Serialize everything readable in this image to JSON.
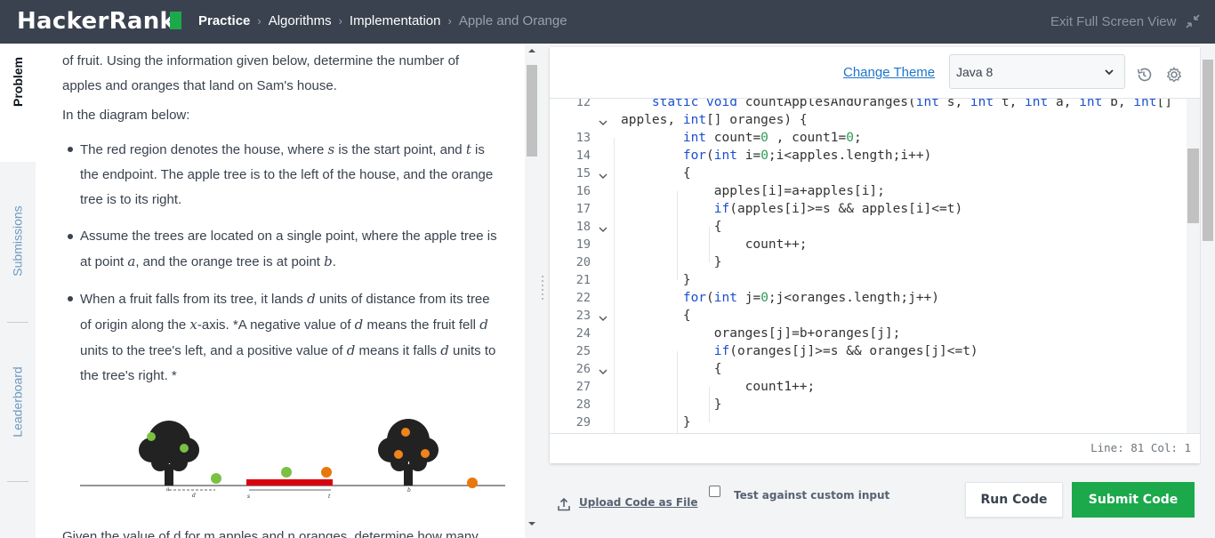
{
  "header": {
    "logo": "HackerRank",
    "breadcrumbs": [
      "Practice",
      "Algorithms",
      "Implementation",
      "Apple and Orange"
    ],
    "exit_label": "Exit Full Screen View"
  },
  "side_tabs": [
    "Problem",
    "Submissions",
    "Leaderboard"
  ],
  "problem": {
    "intro_1": "of fruit. Using the information given below, determine the number of",
    "intro_2": "apples and oranges that land on Sam's house.",
    "diagram_label": "In the diagram below:",
    "bullets": [
      {
        "p1": "The red region denotes the house, where ",
        "v1": "s",
        "p2": " is the start point, and ",
        "v2": "t",
        "p3": " is the endpoint. The apple tree is to the left of the house, and the orange tree is to its right."
      },
      {
        "p1": "Assume the trees are located on a single point, where the apple tree is at point ",
        "v1": "a",
        "p2": ", and the orange tree is at point ",
        "v2": "b",
        "p3": "."
      },
      {
        "p1": "When a fruit falls from its tree, it lands ",
        "v1": "d",
        "p2": " units of distance from its tree of origin along the ",
        "v2": "x",
        "p3": "-axis. *A negative value of ",
        "v3": "d",
        "p4": " means the fruit fell ",
        "v4": "d",
        "p5": " units to the tree's left, and a positive value of ",
        "v5": "d",
        "p6": " means it falls ",
        "v6": "d",
        "p7": " units to the tree's right. *"
      }
    ],
    "diagram_marks": {
      "a": "a",
      "d": "d",
      "s": "s",
      "t": "t",
      "b": "b"
    },
    "cut_text": "Given the value of d for m apples and n oranges, determine how many"
  },
  "editor": {
    "change_theme": "Change Theme",
    "language": "Java 8",
    "status": "Line: 81 Col: 1",
    "lines": [
      {
        "n": "12",
        "fold": false
      },
      {
        "n": "",
        "fold": true
      },
      {
        "n": "13",
        "fold": false
      },
      {
        "n": "14",
        "fold": false
      },
      {
        "n": "15",
        "fold": true
      },
      {
        "n": "16",
        "fold": false
      },
      {
        "n": "17",
        "fold": false
      },
      {
        "n": "18",
        "fold": true
      },
      {
        "n": "19",
        "fold": false
      },
      {
        "n": "20",
        "fold": false
      },
      {
        "n": "21",
        "fold": false
      },
      {
        "n": "22",
        "fold": false
      },
      {
        "n": "23",
        "fold": true
      },
      {
        "n": "24",
        "fold": false
      },
      {
        "n": "25",
        "fold": false
      },
      {
        "n": "26",
        "fold": true
      },
      {
        "n": "27",
        "fold": false
      },
      {
        "n": "28",
        "fold": false
      },
      {
        "n": "29",
        "fold": false
      }
    ],
    "code": [
      "    static void countApplesAndOranges(int s, int t, int a, int b, int[]",
      "apples, int[] oranges) {",
      "        int count=0 , count1=0;",
      "        for(int i=0;i<apples.length;i++)",
      "        {",
      "            apples[i]=a+apples[i];",
      "            if(apples[i]>=s && apples[i]<=t)",
      "            {",
      "                count++;",
      "            }",
      "        }",
      "        for(int j=0;j<oranges.length;j++)",
      "        {",
      "            oranges[j]=b+oranges[j];",
      "            if(oranges[j]>=s && oranges[j]<=t)",
      "            {",
      "                count1++;",
      "            }",
      "        }"
    ]
  },
  "footer": {
    "upload_label": "Upload Code as File",
    "custom_input_label": "Test against custom input",
    "run_label": "Run Code",
    "submit_label": "Submit Code"
  },
  "colors": {
    "brand_green": "#1ba94c",
    "header_bg": "#39424e",
    "link_blue": "#1f75c7"
  }
}
